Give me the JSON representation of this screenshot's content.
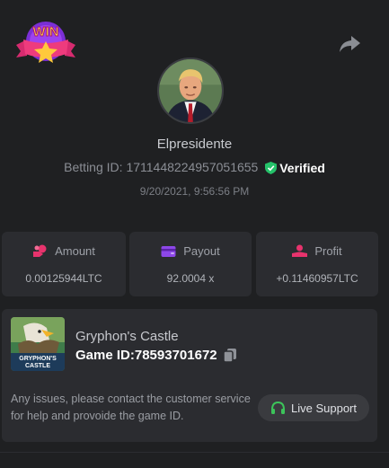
{
  "badge": {
    "text": "WIN"
  },
  "user": {
    "username": "Elpresidente",
    "betting_id_label": "Betting ID:",
    "betting_id": "1711448224957051655",
    "verified_label": "Verified",
    "timestamp": "9/20/2021, 9:56:56 PM"
  },
  "stats": {
    "amount": {
      "label": "Amount",
      "value": "0.00125944LTC",
      "icon": "coins-icon"
    },
    "payout": {
      "label": "Payout",
      "value": "92.0004 x",
      "icon": "wallet-icon"
    },
    "profit": {
      "label": "Profit",
      "value": "+0.11460957LTC",
      "icon": "hand-coin-icon"
    }
  },
  "game": {
    "name": "Gryphon's Castle",
    "id_label": "Game ID:",
    "id": "78593701672",
    "thumb_title": "GRYPHON'S CASTLE"
  },
  "support": {
    "issues_text": "Any issues, please contact the customer service for help and provoide the game ID.",
    "button_label": "Live Support"
  },
  "colors": {
    "background": "#1f2022",
    "card": "#2b2c30",
    "accent_pink": "#e8336d",
    "accent_purple": "#8d47e8",
    "verified_green": "#25c26a",
    "support_green": "#3cc45a"
  }
}
